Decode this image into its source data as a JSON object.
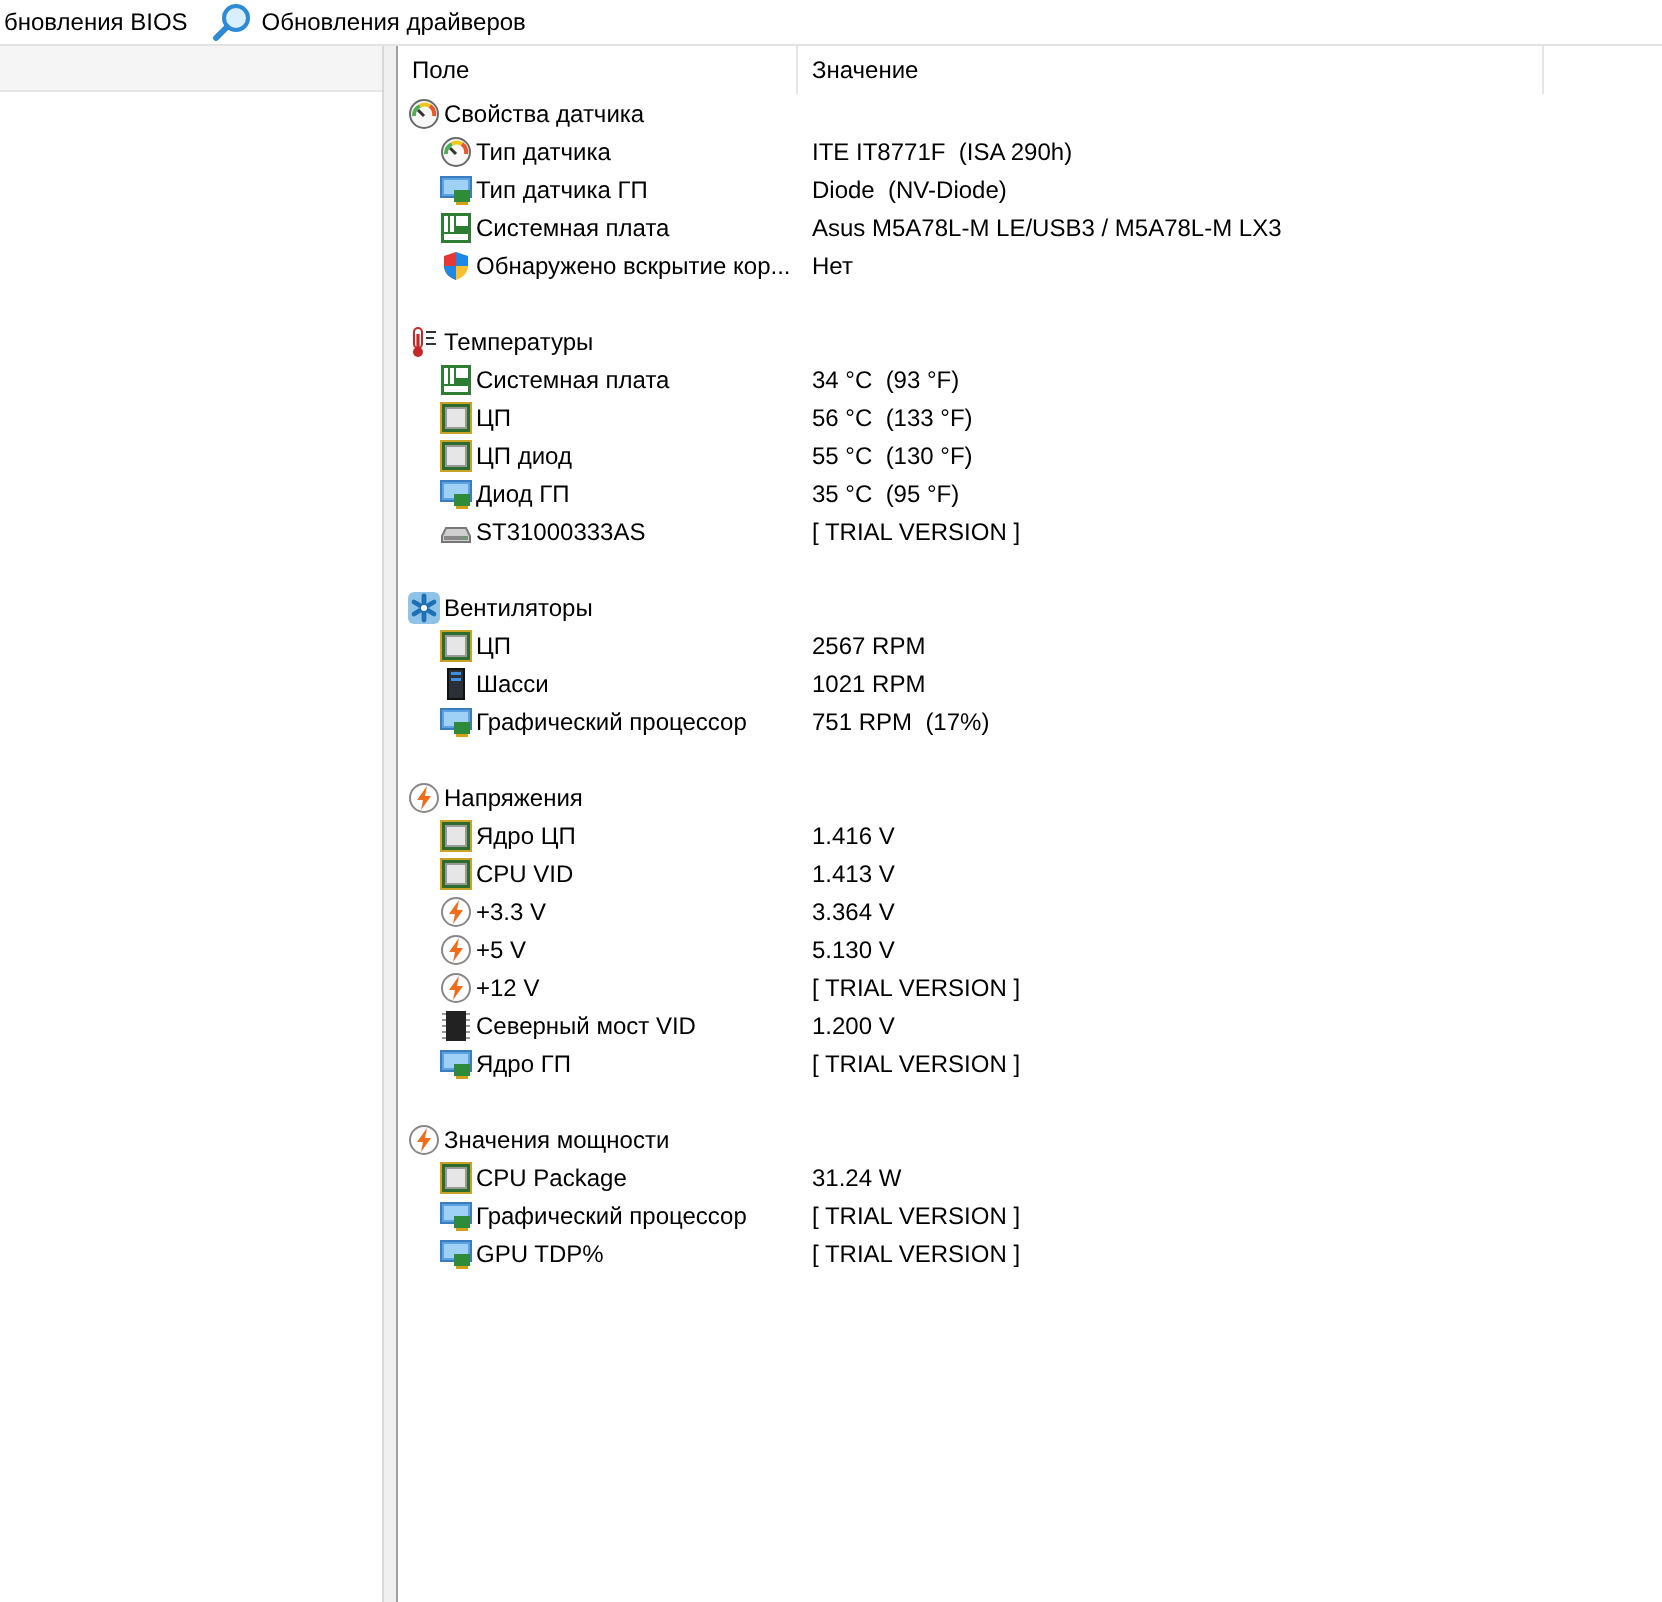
{
  "toolbar": [
    {
      "label": "бновления BIOS",
      "kind": "plain"
    },
    {
      "label": "Обновления драйверов",
      "kind": "search"
    }
  ],
  "table": {
    "columns": [
      "Поле",
      "Значение"
    ],
    "groups": [
      {
        "kind": "gauge",
        "title": "Свойства датчика",
        "rows": [
          {
            "kind": "gauge",
            "field": "Тип датчика",
            "value": "ITE IT8771F  (ISA 290h)"
          },
          {
            "kind": "gpu",
            "field": "Тип датчика ГП",
            "value": "Diode  (NV-Diode)"
          },
          {
            "kind": "board",
            "field": "Системная плата",
            "value": "Asus M5A78L-M LE/USB3 / M5A78L-M LX3"
          },
          {
            "kind": "shield",
            "field": "Обнаружено вскрытие кор...",
            "value": "Нет"
          }
        ]
      },
      {
        "kind": "thermo",
        "title": "Температуры",
        "rows": [
          {
            "kind": "board",
            "field": "Системная плата",
            "value": "34 °C  (93 °F)"
          },
          {
            "kind": "cpu",
            "field": "ЦП",
            "value": "56 °C  (133 °F)"
          },
          {
            "kind": "cpu",
            "field": "ЦП диод",
            "value": "55 °C  (130 °F)"
          },
          {
            "kind": "gpu",
            "field": "Диод ГП",
            "value": "35 °C  (95 °F)"
          },
          {
            "kind": "hdd",
            "field": "ST31000333AS",
            "value": "[ TRIAL VERSION ]"
          }
        ]
      },
      {
        "kind": "fan",
        "title": "Вентиляторы",
        "rows": [
          {
            "kind": "cpu",
            "field": "ЦП",
            "value": "2567 RPM"
          },
          {
            "kind": "tower",
            "field": "Шасси",
            "value": "1021 RPM"
          },
          {
            "kind": "gpu",
            "field": "Графический процессор",
            "value": "751 RPM  (17%)"
          }
        ]
      },
      {
        "kind": "bolt",
        "title": "Напряжения",
        "rows": [
          {
            "kind": "cpu",
            "field": "Ядро ЦП",
            "value": "1.416 V"
          },
          {
            "kind": "cpu",
            "field": "CPU VID",
            "value": "1.413 V"
          },
          {
            "kind": "bolt",
            "field": "+3.3 V",
            "value": "3.364 V"
          },
          {
            "kind": "bolt",
            "field": "+5 V",
            "value": "5.130 V"
          },
          {
            "kind": "bolt",
            "field": "+12 V",
            "value": "[ TRIAL VERSION ]"
          },
          {
            "kind": "chip",
            "field": "Северный мост VID",
            "value": "1.200 V"
          },
          {
            "kind": "gpu",
            "field": "Ядро ГП",
            "value": "[ TRIAL VERSION ]"
          }
        ]
      },
      {
        "kind": "bolt",
        "title": "Значения мощности",
        "rows": [
          {
            "kind": "cpu",
            "field": "CPU Package",
            "value": "31.24 W"
          },
          {
            "kind": "gpu",
            "field": "Графический процессор",
            "value": "[ TRIAL VERSION ]"
          },
          {
            "kind": "gpu",
            "field": "GPU TDP%",
            "value": "[ TRIAL VERSION ]"
          }
        ]
      }
    ]
  }
}
